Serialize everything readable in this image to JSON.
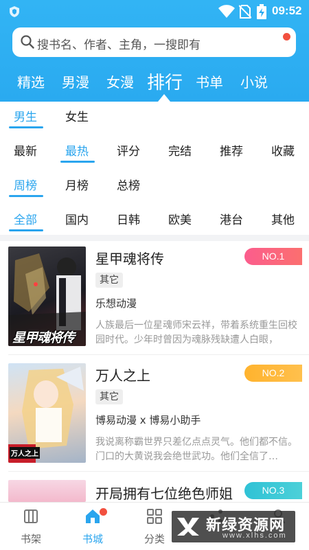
{
  "status_bar": {
    "time": "09:52"
  },
  "search": {
    "placeholder": "搜书名、作者、主角，一搜即有"
  },
  "nav_tabs": [
    {
      "label": "精选"
    },
    {
      "label": "男漫"
    },
    {
      "label": "女漫"
    },
    {
      "label": "排行",
      "active": true
    },
    {
      "label": "书单"
    },
    {
      "label": "小说"
    }
  ],
  "filters": {
    "gender": [
      "男生",
      "女生"
    ],
    "sort": [
      "最新",
      "最热",
      "评分",
      "完结",
      "推荐",
      "收藏"
    ],
    "period": [
      "周榜",
      "月榜",
      "总榜"
    ],
    "region": [
      "全部",
      "国内",
      "日韩",
      "欧美",
      "港台",
      "其他"
    ]
  },
  "books": [
    {
      "title": "星甲魂将传",
      "rank": "NO.1",
      "tag": "其它",
      "author": "乐想动漫",
      "desc": "人族最后一位星魂师宋云祥，带着系统重生回校园时代。少年时曾因为魂脉残缺遭人白眼，",
      "cover_text": "星甲魂将传"
    },
    {
      "title": "万人之上",
      "rank": "NO.2",
      "tag": "其它",
      "author": "博易动漫 x 博易小助手",
      "desc": "我说离称霸世界只差亿点点灵气。他们都不信。门口的大黄说我会绝世武功。他们全信了…",
      "cover_text": "万人之上"
    },
    {
      "title": "开局拥有七位绝色师姐",
      "rank": "NO.3"
    }
  ],
  "bottom_nav": [
    {
      "label": "书架"
    },
    {
      "label": "书城",
      "active": true
    },
    {
      "label": "分类"
    }
  ],
  "watermark": {
    "title": "新绿资源网",
    "url": "www.xlhs.com"
  },
  "colors": {
    "accent": "#2aa5ee",
    "header": "#32b4f4",
    "rank1": "#f95a7e",
    "rank2": "#ffb13a",
    "rank3": "#34c4d8"
  }
}
